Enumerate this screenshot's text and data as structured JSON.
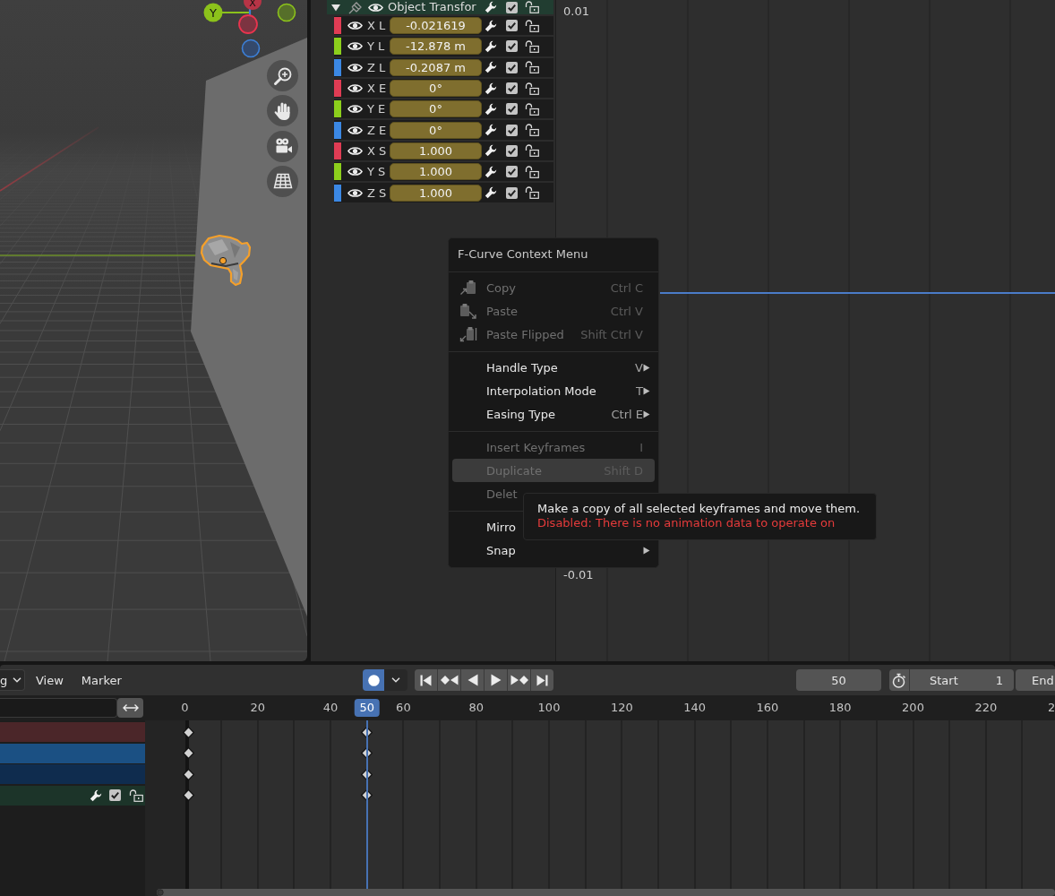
{
  "viewport": {
    "gizmo": {
      "x_label": "X",
      "y_label": "Y"
    }
  },
  "graph_editor": {
    "group": {
      "label": "Object Transfor",
      "expanded": true,
      "visible": true,
      "checked": true,
      "locked": false
    },
    "channels": [
      {
        "label": "X L",
        "value": "-0.021619",
        "color": "#e03c54",
        "visible": true,
        "checked": true,
        "locked": false
      },
      {
        "label": "Y L",
        "value": "-12.878 m",
        "color": "#8ccf1c",
        "visible": true,
        "checked": true,
        "locked": false
      },
      {
        "label": "Z L",
        "value": "-0.2087 m",
        "color": "#3b88e4",
        "visible": true,
        "checked": true,
        "locked": false
      },
      {
        "label": "X E",
        "value": "0°",
        "color": "#e03c54",
        "visible": true,
        "checked": true,
        "locked": false
      },
      {
        "label": "Y E",
        "value": "0°",
        "color": "#8ccf1c",
        "visible": true,
        "checked": true,
        "locked": false
      },
      {
        "label": "Z E",
        "value": "0°",
        "color": "#3b88e4",
        "visible": true,
        "checked": true,
        "locked": false
      },
      {
        "label": "X S",
        "value": "1.000",
        "color": "#e03c54",
        "visible": true,
        "checked": true,
        "locked": false
      },
      {
        "label": "Y S",
        "value": "1.000",
        "color": "#8ccf1c",
        "visible": true,
        "checked": true,
        "locked": false
      },
      {
        "label": "Z S",
        "value": "1.000",
        "color": "#3b88e4",
        "visible": true,
        "checked": true,
        "locked": false
      }
    ],
    "y_labels": [
      "0.01",
      "-0.01"
    ]
  },
  "context_menu": {
    "title": "F-Curve Context Menu",
    "sections": [
      [
        {
          "label": "Copy",
          "shortcut": "Ctrl C",
          "disabled": true,
          "selected": false,
          "submenu": false
        },
        {
          "label": "Paste",
          "shortcut": "Ctrl V",
          "disabled": true,
          "selected": false,
          "submenu": false
        },
        {
          "label": "Paste Flipped",
          "shortcut": "Shift Ctrl V",
          "disabled": true,
          "selected": false,
          "submenu": false
        }
      ],
      [
        {
          "label": "Handle Type",
          "shortcut": "V",
          "disabled": false,
          "selected": false,
          "submenu": true
        },
        {
          "label": "Interpolation Mode",
          "shortcut": "T",
          "disabled": false,
          "selected": false,
          "submenu": true
        },
        {
          "label": "Easing Type",
          "shortcut": "Ctrl E",
          "disabled": false,
          "selected": false,
          "submenu": true
        }
      ],
      [
        {
          "label": "Insert Keyframes",
          "shortcut": "I",
          "disabled": true,
          "selected": false,
          "submenu": false
        },
        {
          "label": "Duplicate",
          "shortcut": "Shift D",
          "disabled": true,
          "selected": true,
          "submenu": false
        },
        {
          "label": "Delet",
          "disabled": true,
          "selected": false,
          "submenu": false
        }
      ],
      [
        {
          "label": "Mirro",
          "disabled": false,
          "selected": false
        },
        {
          "label": "Snap",
          "disabled": false,
          "selected": false,
          "submenu": true
        }
      ]
    ]
  },
  "tooltip": {
    "description": "Make a copy of all selected keyframes and move them.",
    "disabled_reason": "Disabled: There is no animation data to operate on"
  },
  "timeline": {
    "header": {
      "mode_dropdown": "g",
      "menus": [
        "View",
        "Marker"
      ],
      "auto_keying": true,
      "current_frame": "50",
      "start": {
        "label": "Start",
        "value": "1"
      },
      "end": {
        "label": "End"
      }
    },
    "frame_labels": [
      {
        "label": "0",
        "selected": false
      },
      {
        "label": "20",
        "selected": false
      },
      {
        "label": "40",
        "selected": false
      },
      {
        "label": "50",
        "selected": true
      },
      {
        "label": "60",
        "selected": false
      },
      {
        "label": "80",
        "selected": false
      },
      {
        "label": "100",
        "selected": false
      },
      {
        "label": "120",
        "selected": false
      },
      {
        "label": "140",
        "selected": false
      },
      {
        "label": "160",
        "selected": false
      },
      {
        "label": "180",
        "selected": false
      },
      {
        "label": "200",
        "selected": false
      },
      {
        "label": "220",
        "selected": false
      },
      {
        "label": "2",
        "selected": false
      }
    ],
    "channels": [
      {
        "kind": "summary",
        "color": "#4b2629"
      },
      {
        "kind": "object",
        "color": "#1b5083"
      },
      {
        "kind": "action",
        "color": "#0f2c4e"
      },
      {
        "kind": "group",
        "color": "#1c3429",
        "checked": true,
        "locked": false
      }
    ]
  }
}
